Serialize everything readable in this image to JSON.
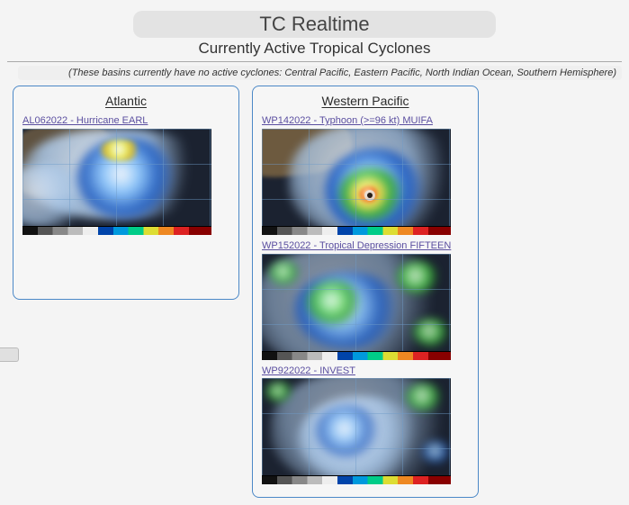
{
  "title": "TC Realtime",
  "subtitle": "Currently Active Tropical Cyclones",
  "inactive_note": "(These basins currently have no active cyclones: Central Pacific, Eastern Pacific, North Indian Ocean, Southern Hemisphere)",
  "basins": {
    "atlantic": {
      "header": "Atlantic",
      "storms": [
        {
          "label": "AL062022 - Hurricane EARL"
        }
      ]
    },
    "wpac": {
      "header": "Western Pacific",
      "storms": [
        {
          "label": "WP142022 - Typhoon (>=96 kt) MUIFA"
        },
        {
          "label": "WP152022 - Tropical Depression FIFTEEN"
        },
        {
          "label": "WP922022 - INVEST"
        }
      ]
    }
  }
}
